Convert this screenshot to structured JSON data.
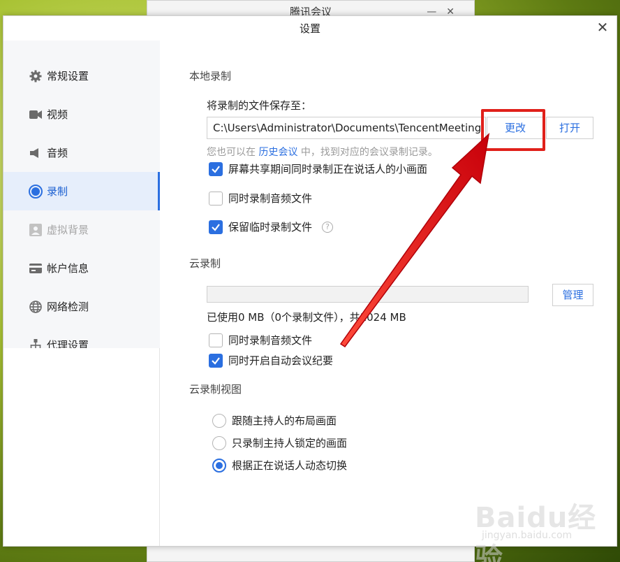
{
  "background_window": {
    "title": "腾讯会议"
  },
  "window": {
    "title": "设置"
  },
  "sidebar": {
    "items": [
      {
        "label": "常规设置",
        "icon": "gear-icon"
      },
      {
        "label": "视频",
        "icon": "camera-icon"
      },
      {
        "label": "音频",
        "icon": "speaker-icon"
      },
      {
        "label": "录制",
        "icon": "record-icon",
        "active": true
      },
      {
        "label": "虚拟背景",
        "icon": "portrait-icon",
        "disabled": true
      },
      {
        "label": "帐户信息",
        "icon": "card-icon"
      },
      {
        "label": "网络检测",
        "icon": "globe-icon"
      },
      {
        "label": "代理设置",
        "icon": "network-icon"
      }
    ]
  },
  "local": {
    "section_title": "本地录制",
    "save_label": "将录制的文件保存至：",
    "path": "C:\\Users\\Administrator\\Documents\\TencentMeeting",
    "change_button": "更改",
    "open_button": "打开",
    "hint_prefix": "您也可以在",
    "hint_link": "历史会议",
    "hint_suffix": "中，找到对应的会议录制记录。",
    "options": [
      {
        "label": "屏幕共享期间同时录制正在说话人的小画面",
        "checked": true
      },
      {
        "label": "同时录制音频文件",
        "checked": false
      },
      {
        "label": "保留临时录制文件",
        "checked": true
      }
    ]
  },
  "cloud": {
    "section_title": "云录制",
    "manage_button": "管理",
    "usage_text": "已使用0 MB（0个录制文件），共1024 MB",
    "options": [
      {
        "label": "同时录制音频文件",
        "checked": false
      },
      {
        "label": "同时开启自动会议纪要",
        "checked": true
      }
    ]
  },
  "cloud_view": {
    "section_title": "云录制视图",
    "options": [
      {
        "label": "跟随主持人的布局画面",
        "checked": false
      },
      {
        "label": "只录制主持人锁定的画面",
        "checked": false
      },
      {
        "label": "根据正在说话人动态切换",
        "checked": true
      }
    ]
  },
  "watermark": {
    "text": "Baidu经验",
    "sub": "jingyan.baidu.com"
  },
  "colors": {
    "accent": "#2b6fe0",
    "highlight": "#e0201a",
    "active_bg": "#e6eefb"
  }
}
